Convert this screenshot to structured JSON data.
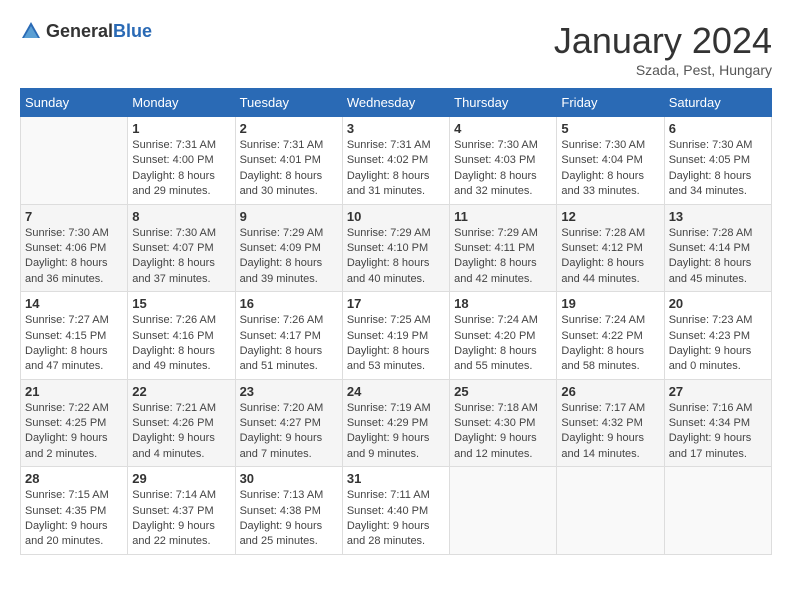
{
  "logo": {
    "general": "General",
    "blue": "Blue"
  },
  "header": {
    "month": "January 2024",
    "location": "Szada, Pest, Hungary"
  },
  "weekdays": [
    "Sunday",
    "Monday",
    "Tuesday",
    "Wednesday",
    "Thursday",
    "Friday",
    "Saturday"
  ],
  "weeks": [
    [
      {
        "day": "",
        "sunrise": "",
        "sunset": "",
        "daylight": ""
      },
      {
        "day": "1",
        "sunrise": "Sunrise: 7:31 AM",
        "sunset": "Sunset: 4:00 PM",
        "daylight": "Daylight: 8 hours and 29 minutes."
      },
      {
        "day": "2",
        "sunrise": "Sunrise: 7:31 AM",
        "sunset": "Sunset: 4:01 PM",
        "daylight": "Daylight: 8 hours and 30 minutes."
      },
      {
        "day": "3",
        "sunrise": "Sunrise: 7:31 AM",
        "sunset": "Sunset: 4:02 PM",
        "daylight": "Daylight: 8 hours and 31 minutes."
      },
      {
        "day": "4",
        "sunrise": "Sunrise: 7:30 AM",
        "sunset": "Sunset: 4:03 PM",
        "daylight": "Daylight: 8 hours and 32 minutes."
      },
      {
        "day": "5",
        "sunrise": "Sunrise: 7:30 AM",
        "sunset": "Sunset: 4:04 PM",
        "daylight": "Daylight: 8 hours and 33 minutes."
      },
      {
        "day": "6",
        "sunrise": "Sunrise: 7:30 AM",
        "sunset": "Sunset: 4:05 PM",
        "daylight": "Daylight: 8 hours and 34 minutes."
      }
    ],
    [
      {
        "day": "7",
        "sunrise": "Sunrise: 7:30 AM",
        "sunset": "Sunset: 4:06 PM",
        "daylight": "Daylight: 8 hours and 36 minutes."
      },
      {
        "day": "8",
        "sunrise": "Sunrise: 7:30 AM",
        "sunset": "Sunset: 4:07 PM",
        "daylight": "Daylight: 8 hours and 37 minutes."
      },
      {
        "day": "9",
        "sunrise": "Sunrise: 7:29 AM",
        "sunset": "Sunset: 4:09 PM",
        "daylight": "Daylight: 8 hours and 39 minutes."
      },
      {
        "day": "10",
        "sunrise": "Sunrise: 7:29 AM",
        "sunset": "Sunset: 4:10 PM",
        "daylight": "Daylight: 8 hours and 40 minutes."
      },
      {
        "day": "11",
        "sunrise": "Sunrise: 7:29 AM",
        "sunset": "Sunset: 4:11 PM",
        "daylight": "Daylight: 8 hours and 42 minutes."
      },
      {
        "day": "12",
        "sunrise": "Sunrise: 7:28 AM",
        "sunset": "Sunset: 4:12 PM",
        "daylight": "Daylight: 8 hours and 44 minutes."
      },
      {
        "day": "13",
        "sunrise": "Sunrise: 7:28 AM",
        "sunset": "Sunset: 4:14 PM",
        "daylight": "Daylight: 8 hours and 45 minutes."
      }
    ],
    [
      {
        "day": "14",
        "sunrise": "Sunrise: 7:27 AM",
        "sunset": "Sunset: 4:15 PM",
        "daylight": "Daylight: 8 hours and 47 minutes."
      },
      {
        "day": "15",
        "sunrise": "Sunrise: 7:26 AM",
        "sunset": "Sunset: 4:16 PM",
        "daylight": "Daylight: 8 hours and 49 minutes."
      },
      {
        "day": "16",
        "sunrise": "Sunrise: 7:26 AM",
        "sunset": "Sunset: 4:17 PM",
        "daylight": "Daylight: 8 hours and 51 minutes."
      },
      {
        "day": "17",
        "sunrise": "Sunrise: 7:25 AM",
        "sunset": "Sunset: 4:19 PM",
        "daylight": "Daylight: 8 hours and 53 minutes."
      },
      {
        "day": "18",
        "sunrise": "Sunrise: 7:24 AM",
        "sunset": "Sunset: 4:20 PM",
        "daylight": "Daylight: 8 hours and 55 minutes."
      },
      {
        "day": "19",
        "sunrise": "Sunrise: 7:24 AM",
        "sunset": "Sunset: 4:22 PM",
        "daylight": "Daylight: 8 hours and 58 minutes."
      },
      {
        "day": "20",
        "sunrise": "Sunrise: 7:23 AM",
        "sunset": "Sunset: 4:23 PM",
        "daylight": "Daylight: 9 hours and 0 minutes."
      }
    ],
    [
      {
        "day": "21",
        "sunrise": "Sunrise: 7:22 AM",
        "sunset": "Sunset: 4:25 PM",
        "daylight": "Daylight: 9 hours and 2 minutes."
      },
      {
        "day": "22",
        "sunrise": "Sunrise: 7:21 AM",
        "sunset": "Sunset: 4:26 PM",
        "daylight": "Daylight: 9 hours and 4 minutes."
      },
      {
        "day": "23",
        "sunrise": "Sunrise: 7:20 AM",
        "sunset": "Sunset: 4:27 PM",
        "daylight": "Daylight: 9 hours and 7 minutes."
      },
      {
        "day": "24",
        "sunrise": "Sunrise: 7:19 AM",
        "sunset": "Sunset: 4:29 PM",
        "daylight": "Daylight: 9 hours and 9 minutes."
      },
      {
        "day": "25",
        "sunrise": "Sunrise: 7:18 AM",
        "sunset": "Sunset: 4:30 PM",
        "daylight": "Daylight: 9 hours and 12 minutes."
      },
      {
        "day": "26",
        "sunrise": "Sunrise: 7:17 AM",
        "sunset": "Sunset: 4:32 PM",
        "daylight": "Daylight: 9 hours and 14 minutes."
      },
      {
        "day": "27",
        "sunrise": "Sunrise: 7:16 AM",
        "sunset": "Sunset: 4:34 PM",
        "daylight": "Daylight: 9 hours and 17 minutes."
      }
    ],
    [
      {
        "day": "28",
        "sunrise": "Sunrise: 7:15 AM",
        "sunset": "Sunset: 4:35 PM",
        "daylight": "Daylight: 9 hours and 20 minutes."
      },
      {
        "day": "29",
        "sunrise": "Sunrise: 7:14 AM",
        "sunset": "Sunset: 4:37 PM",
        "daylight": "Daylight: 9 hours and 22 minutes."
      },
      {
        "day": "30",
        "sunrise": "Sunrise: 7:13 AM",
        "sunset": "Sunset: 4:38 PM",
        "daylight": "Daylight: 9 hours and 25 minutes."
      },
      {
        "day": "31",
        "sunrise": "Sunrise: 7:11 AM",
        "sunset": "Sunset: 4:40 PM",
        "daylight": "Daylight: 9 hours and 28 minutes."
      },
      {
        "day": "",
        "sunrise": "",
        "sunset": "",
        "daylight": ""
      },
      {
        "day": "",
        "sunrise": "",
        "sunset": "",
        "daylight": ""
      },
      {
        "day": "",
        "sunrise": "",
        "sunset": "",
        "daylight": ""
      }
    ]
  ]
}
